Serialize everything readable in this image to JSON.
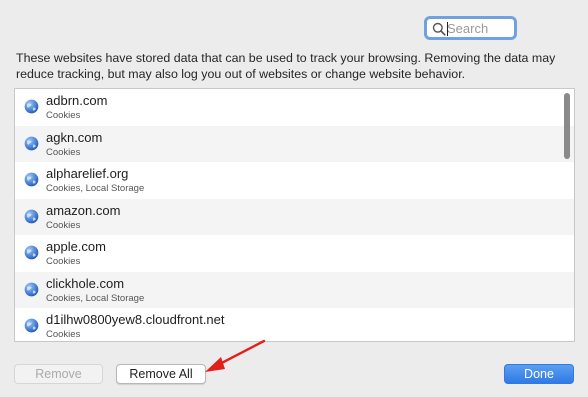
{
  "search": {
    "placeholder": "Search",
    "value": ""
  },
  "description": "These websites have stored data that can be used to track your browsing. Removing the data may reduce tracking, but may also log you out of websites or change website behavior.",
  "websites": [
    {
      "domain": "adbrn.com",
      "data": "Cookies"
    },
    {
      "domain": "agkn.com",
      "data": "Cookies"
    },
    {
      "domain": "alpharelief.org",
      "data": "Cookies, Local Storage"
    },
    {
      "domain": "amazon.com",
      "data": "Cookies"
    },
    {
      "domain": "apple.com",
      "data": "Cookies"
    },
    {
      "domain": "clickhole.com",
      "data": "Cookies, Local Storage"
    },
    {
      "domain": "d1ilhw0800yew8.cloudfront.net",
      "data": "Cookies"
    }
  ],
  "buttons": {
    "remove": "Remove",
    "remove_all": "Remove All",
    "done": "Done"
  },
  "colors": {
    "accent": "#2f7ae5",
    "annotation_arrow": "#e0201b",
    "globe": "#2f6fcf"
  },
  "icons": {
    "search": "magnifying-glass-icon",
    "site": "globe-icon",
    "annotation": "red-arrow"
  }
}
